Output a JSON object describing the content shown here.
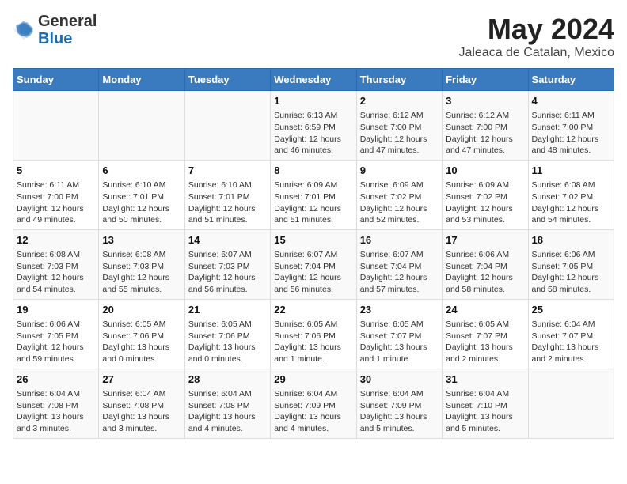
{
  "header": {
    "logo_general": "General",
    "logo_blue": "Blue",
    "month_title": "May 2024",
    "location": "Jaleaca de Catalan, Mexico"
  },
  "days_of_week": [
    "Sunday",
    "Monday",
    "Tuesday",
    "Wednesday",
    "Thursday",
    "Friday",
    "Saturday"
  ],
  "weeks": [
    [
      {
        "day": "",
        "info": ""
      },
      {
        "day": "",
        "info": ""
      },
      {
        "day": "",
        "info": ""
      },
      {
        "day": "1",
        "info": "Sunrise: 6:13 AM\nSunset: 6:59 PM\nDaylight: 12 hours and 46 minutes."
      },
      {
        "day": "2",
        "info": "Sunrise: 6:12 AM\nSunset: 7:00 PM\nDaylight: 12 hours and 47 minutes."
      },
      {
        "day": "3",
        "info": "Sunrise: 6:12 AM\nSunset: 7:00 PM\nDaylight: 12 hours and 47 minutes."
      },
      {
        "day": "4",
        "info": "Sunrise: 6:11 AM\nSunset: 7:00 PM\nDaylight: 12 hours and 48 minutes."
      }
    ],
    [
      {
        "day": "5",
        "info": "Sunrise: 6:11 AM\nSunset: 7:00 PM\nDaylight: 12 hours and 49 minutes."
      },
      {
        "day": "6",
        "info": "Sunrise: 6:10 AM\nSunset: 7:01 PM\nDaylight: 12 hours and 50 minutes."
      },
      {
        "day": "7",
        "info": "Sunrise: 6:10 AM\nSunset: 7:01 PM\nDaylight: 12 hours and 51 minutes."
      },
      {
        "day": "8",
        "info": "Sunrise: 6:09 AM\nSunset: 7:01 PM\nDaylight: 12 hours and 51 minutes."
      },
      {
        "day": "9",
        "info": "Sunrise: 6:09 AM\nSunset: 7:02 PM\nDaylight: 12 hours and 52 minutes."
      },
      {
        "day": "10",
        "info": "Sunrise: 6:09 AM\nSunset: 7:02 PM\nDaylight: 12 hours and 53 minutes."
      },
      {
        "day": "11",
        "info": "Sunrise: 6:08 AM\nSunset: 7:02 PM\nDaylight: 12 hours and 54 minutes."
      }
    ],
    [
      {
        "day": "12",
        "info": "Sunrise: 6:08 AM\nSunset: 7:03 PM\nDaylight: 12 hours and 54 minutes."
      },
      {
        "day": "13",
        "info": "Sunrise: 6:08 AM\nSunset: 7:03 PM\nDaylight: 12 hours and 55 minutes."
      },
      {
        "day": "14",
        "info": "Sunrise: 6:07 AM\nSunset: 7:03 PM\nDaylight: 12 hours and 56 minutes."
      },
      {
        "day": "15",
        "info": "Sunrise: 6:07 AM\nSunset: 7:04 PM\nDaylight: 12 hours and 56 minutes."
      },
      {
        "day": "16",
        "info": "Sunrise: 6:07 AM\nSunset: 7:04 PM\nDaylight: 12 hours and 57 minutes."
      },
      {
        "day": "17",
        "info": "Sunrise: 6:06 AM\nSunset: 7:04 PM\nDaylight: 12 hours and 58 minutes."
      },
      {
        "day": "18",
        "info": "Sunrise: 6:06 AM\nSunset: 7:05 PM\nDaylight: 12 hours and 58 minutes."
      }
    ],
    [
      {
        "day": "19",
        "info": "Sunrise: 6:06 AM\nSunset: 7:05 PM\nDaylight: 12 hours and 59 minutes."
      },
      {
        "day": "20",
        "info": "Sunrise: 6:05 AM\nSunset: 7:06 PM\nDaylight: 13 hours and 0 minutes."
      },
      {
        "day": "21",
        "info": "Sunrise: 6:05 AM\nSunset: 7:06 PM\nDaylight: 13 hours and 0 minutes."
      },
      {
        "day": "22",
        "info": "Sunrise: 6:05 AM\nSunset: 7:06 PM\nDaylight: 13 hours and 1 minute."
      },
      {
        "day": "23",
        "info": "Sunrise: 6:05 AM\nSunset: 7:07 PM\nDaylight: 13 hours and 1 minute."
      },
      {
        "day": "24",
        "info": "Sunrise: 6:05 AM\nSunset: 7:07 PM\nDaylight: 13 hours and 2 minutes."
      },
      {
        "day": "25",
        "info": "Sunrise: 6:04 AM\nSunset: 7:07 PM\nDaylight: 13 hours and 2 minutes."
      }
    ],
    [
      {
        "day": "26",
        "info": "Sunrise: 6:04 AM\nSunset: 7:08 PM\nDaylight: 13 hours and 3 minutes."
      },
      {
        "day": "27",
        "info": "Sunrise: 6:04 AM\nSunset: 7:08 PM\nDaylight: 13 hours and 3 minutes."
      },
      {
        "day": "28",
        "info": "Sunrise: 6:04 AM\nSunset: 7:08 PM\nDaylight: 13 hours and 4 minutes."
      },
      {
        "day": "29",
        "info": "Sunrise: 6:04 AM\nSunset: 7:09 PM\nDaylight: 13 hours and 4 minutes."
      },
      {
        "day": "30",
        "info": "Sunrise: 6:04 AM\nSunset: 7:09 PM\nDaylight: 13 hours and 5 minutes."
      },
      {
        "day": "31",
        "info": "Sunrise: 6:04 AM\nSunset: 7:10 PM\nDaylight: 13 hours and 5 minutes."
      },
      {
        "day": "",
        "info": ""
      }
    ]
  ]
}
